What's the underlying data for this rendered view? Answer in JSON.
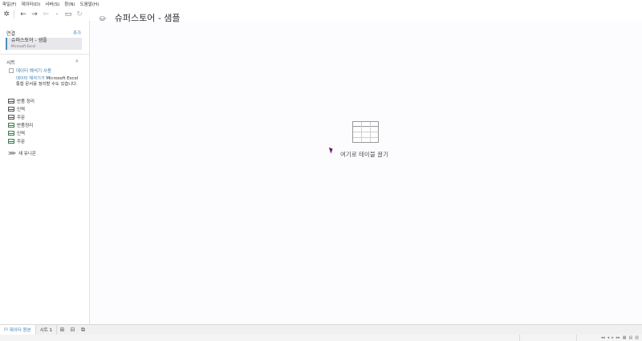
{
  "menu": [
    "파일(F)",
    "데이터(D)",
    "서버(S)",
    "창(N)",
    "도움말(H)"
  ],
  "toolbar": {
    "tableau_icon": "tableau-logo-icon",
    "back": "←",
    "forward": "→",
    "save": "▭",
    "refresh": "↻"
  },
  "connections": {
    "title": "연결",
    "add_label": "추가",
    "items": [
      {
        "name": "슈퍼스토어 - 샘플",
        "type": "Microsoft Excel"
      }
    ]
  },
  "sheets": {
    "title": "시트",
    "interpreter_label": "데이터 해석기 사용",
    "interpreter_desc_link": "데이터 해석기가",
    "interpreter_desc_rest": "Microsoft Excel 통합 문서를 정리할 수도 있습니다.",
    "items": [
      {
        "label": "반품 정리",
        "kind": "table"
      },
      {
        "label": "인력",
        "kind": "table"
      },
      {
        "label": "주문",
        "kind": "table"
      },
      {
        "label": "반품정리",
        "kind": "range"
      },
      {
        "label": "인력",
        "kind": "range"
      },
      {
        "label": "주문",
        "kind": "range"
      }
    ],
    "new_union": "새 유니온"
  },
  "canvas": {
    "title": "슈퍼스토어 - 샘플",
    "drop_hint": "여기로 테이블 끌기"
  },
  "tabs": {
    "datasource": "데이터 원본",
    "sheet1": "시트 1"
  },
  "status": {
    "nav": [
      "◂◂",
      "◂",
      "▸",
      "▸▸"
    ]
  }
}
